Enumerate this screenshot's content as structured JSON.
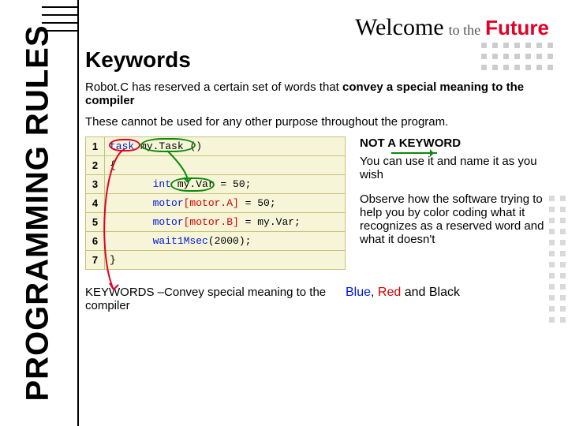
{
  "sidebar": {
    "title": "PROGRAMMING RULES"
  },
  "brand": {
    "welcome": "Welcome",
    "to": "to the",
    "future": "Future"
  },
  "slide": {
    "title": "Keywords",
    "intro_plain": "Robot.C has reserved a certain set of words that ",
    "intro_strong": "convey a special meaning to the compiler",
    "intro2": "These cannot be used for any other purpose throughout the program."
  },
  "code": {
    "rows": [
      {
        "n": "1",
        "pre": "",
        "p1": "task",
        "c1": "kw-blue",
        "p2": " my.Task",
        "c2": "kw-black",
        "p3": " ()",
        "c3": "kw-black"
      },
      {
        "n": "2",
        "pre": "",
        "p1": "{",
        "c1": "kw-black"
      },
      {
        "n": "3",
        "pre": "       ",
        "p1": "int",
        "c1": "kw-blue",
        "p2": " my.Var",
        "c2": "kw-black",
        "p3": " = 50;",
        "c3": "kw-black"
      },
      {
        "n": "4",
        "pre": "       ",
        "p1": "motor",
        "c1": "kw-blue",
        "p2": "[motor.A]",
        "c2": "kw-red",
        "p3": " = 50;",
        "c3": "kw-black"
      },
      {
        "n": "5",
        "pre": "       ",
        "p1": "motor",
        "c1": "kw-blue",
        "p2": "[motor.B]",
        "c2": "kw-red",
        "p3": " = my.Var;",
        "c3": "kw-black"
      },
      {
        "n": "6",
        "pre": "       ",
        "p1": "wait1Msec",
        "c1": "kw-blue",
        "p2": "(2000);",
        "c2": "kw-black"
      },
      {
        "n": "7",
        "pre": "",
        "p1": "}",
        "c1": "kw-black"
      }
    ]
  },
  "notes": {
    "not_keyword": "NOT A KEYWORD",
    "use_name": "You can use it and name it as you wish",
    "observe": "Observe how the software trying to help you by color coding what it recognizes as a reserved word and what it doesn't"
  },
  "bottom": {
    "left": "KEYWORDS –Convey special meaning to the compiler",
    "r_blue": "Blue",
    "r_sep1": ", ",
    "r_red": "Red",
    "r_sep2": " and ",
    "r_black": "Black"
  }
}
